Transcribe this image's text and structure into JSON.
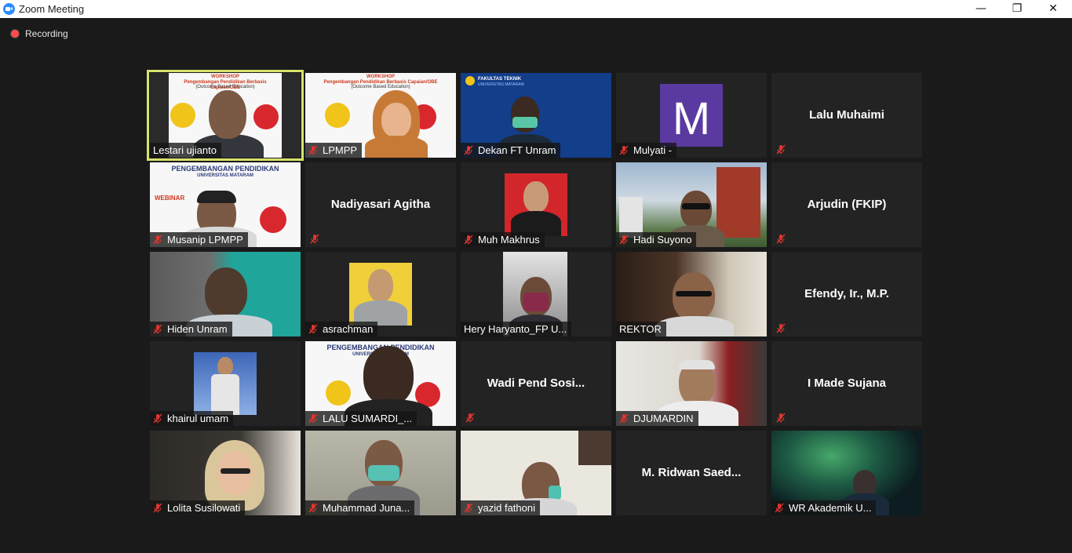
{
  "window": {
    "title": "Zoom Meeting",
    "controls": [
      "minimize-icon",
      "restore-icon",
      "close-icon"
    ]
  },
  "recording": {
    "label": "Recording",
    "color": "#ff4d4d"
  },
  "colors": {
    "active_speaker_border": "#d8e26a",
    "tile_bg": "#232323",
    "background": "#1a1a1a",
    "mute_icon": "#e0352f"
  },
  "participants": [
    {
      "name": "Lestari ujianto",
      "muted": false,
      "video": true,
      "active_speaker": true
    },
    {
      "name": "LPMPP",
      "muted": true,
      "video": true
    },
    {
      "name": "Dekan FT Unram",
      "muted": true,
      "video": true
    },
    {
      "name": "Mulyati -",
      "muted": true,
      "video": true,
      "avatar_letter": "M"
    },
    {
      "name": "Lalu Muhaimi",
      "muted": true,
      "video": false
    },
    {
      "name": "Musanip LPMPP",
      "muted": true,
      "video": true
    },
    {
      "name": "Nadiyasari Agitha",
      "muted": true,
      "video": false
    },
    {
      "name": "Muh Makhrus",
      "muted": true,
      "video": true
    },
    {
      "name": "Hadi Suyono",
      "muted": true,
      "video": true
    },
    {
      "name": "Arjudin (FKIP)",
      "muted": true,
      "video": false
    },
    {
      "name": "Hiden Unram",
      "muted": true,
      "video": true
    },
    {
      "name": "asrachman",
      "muted": true,
      "video": true
    },
    {
      "name": "Hery Haryanto_FP U...",
      "muted": false,
      "video": true
    },
    {
      "name": "REKTOR",
      "muted": false,
      "video": true
    },
    {
      "name": "Efendy, Ir., M.P.",
      "muted": true,
      "video": false
    },
    {
      "name": "khairul umam",
      "muted": true,
      "video": true
    },
    {
      "name": "LALU SUMARDI_...",
      "muted": true,
      "video": true
    },
    {
      "name": "Wadi  Pend  Sosi...",
      "muted": true,
      "video": false
    },
    {
      "name": "DJUMARDIN",
      "muted": true,
      "video": true
    },
    {
      "name": "I Made Sujana",
      "muted": true,
      "video": false
    },
    {
      "name": "Lolita Susilowati",
      "muted": true,
      "video": true
    },
    {
      "name": "Muhammad Juna...",
      "muted": true,
      "video": true
    },
    {
      "name": "yazid fathoni",
      "muted": true,
      "video": true
    },
    {
      "name": "M.  Ridwan  Saed...",
      "muted": false,
      "video": false
    },
    {
      "name": "WR Akademik U...",
      "muted": true,
      "video": true
    }
  ],
  "slides": {
    "workshop_title": "WORKSHOP",
    "workshop_sub1": "Pengembangan Pendidikan Berbasis Capaian/OBE",
    "workshop_sub2": "(Outcome Based Education)",
    "ft_logo_text": "FAKULTAS TEKNIK",
    "ft_logo_sub": "UNIVERSITAS MATARAM",
    "pp_title": "PENGEMBANGAN PENDIDIKAN",
    "pp_sub": "UNIVERSITAS MATARAM",
    "webinar": "WEBINAR",
    "lalu_slide_title": "PENGEMBANGAN PENDIDIKAN",
    "lalu_slide_sub": "UNIVERSITAS MATARAM"
  }
}
